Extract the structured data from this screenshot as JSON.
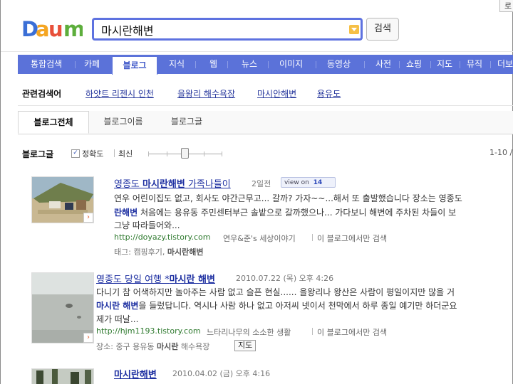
{
  "corner_button": "로",
  "search": {
    "query": "마시란해변",
    "button_label": "검색"
  },
  "nav": {
    "items": [
      "통합검색",
      "카페",
      "블로그",
      "지식",
      "웹",
      "뉴스",
      "이미지",
      "동영상",
      "사전",
      "쇼핑",
      "지도",
      "뮤직",
      "더보"
    ],
    "active": "블로그"
  },
  "related": {
    "title": "관련검색어",
    "links": [
      "하얏트 리젠시 인천",
      "을왕리 해수욕장",
      "마시안해변",
      "용유도"
    ]
  },
  "tabs": [
    "블로그전체",
    "블로그이름",
    "블로그글"
  ],
  "options": {
    "title": "블로그글",
    "accuracy_label": "정확도",
    "recent_label": "최신",
    "accuracy_checked": true,
    "page_info": "1-10 /"
  },
  "results": [
    {
      "title_pre": "영종도 ",
      "title_bold": "마시란해변",
      "title_post": " 가족나들이",
      "date": "2일전",
      "viewon_label": "view on",
      "viewon_count": "14",
      "line1": "연우 어린이집도 없고, 회사도 야간근무고... 갈까? 가자~~...해서 또 출발했습니다 장소는 영종도",
      "line2_bold": "란해변",
      "line2_rest": " 처음에는 용유동 주민센터부근 솔밭으로 갈까했으나... 가다보니 해변에 주차된 차들이 보",
      "line3": "그냥 따라들어와...",
      "url": "http://doyazy.tistory.com",
      "blog_name": "연우&준's 세상이야기",
      "search_in": "이 블로그에서만 검색",
      "tag_prefix": "태그: 캠핑후기,",
      "tag_bold": "마시란해변"
    },
    {
      "title_pre": "영종도 당일 여행 *",
      "title_bold": "마시란 해변",
      "title_post": "",
      "date": "2010.07.22 (목) 오후 4:26",
      "line1": "다니기 참 어색하지만 놀아주는 사람 없고 슬픈 현실......  을왕리나 왕산은 사람이 평일이지만 많을 거",
      "line2_bold": "마시란 해변",
      "line2_rest": "을 들렀답니다. 역시나 사람 하나 없고 아저씨 넷이서 천막에서 하루 종일 예기만 하더군요",
      "line3": "제가 떠날...",
      "url": "http://hjm1193.tistory.com",
      "blog_name": "느타리나무의 소소한 생활",
      "search_in": "이 블로그에서만 검색",
      "place_prefix": "장소: 중구 용유동",
      "place_bold": "마시란",
      "place_post": "해수욕장",
      "map_button": "지도"
    },
    {
      "title_bold": "마시란해변",
      "date": "2010.04.02 (금) 오후 4:16"
    }
  ]
}
